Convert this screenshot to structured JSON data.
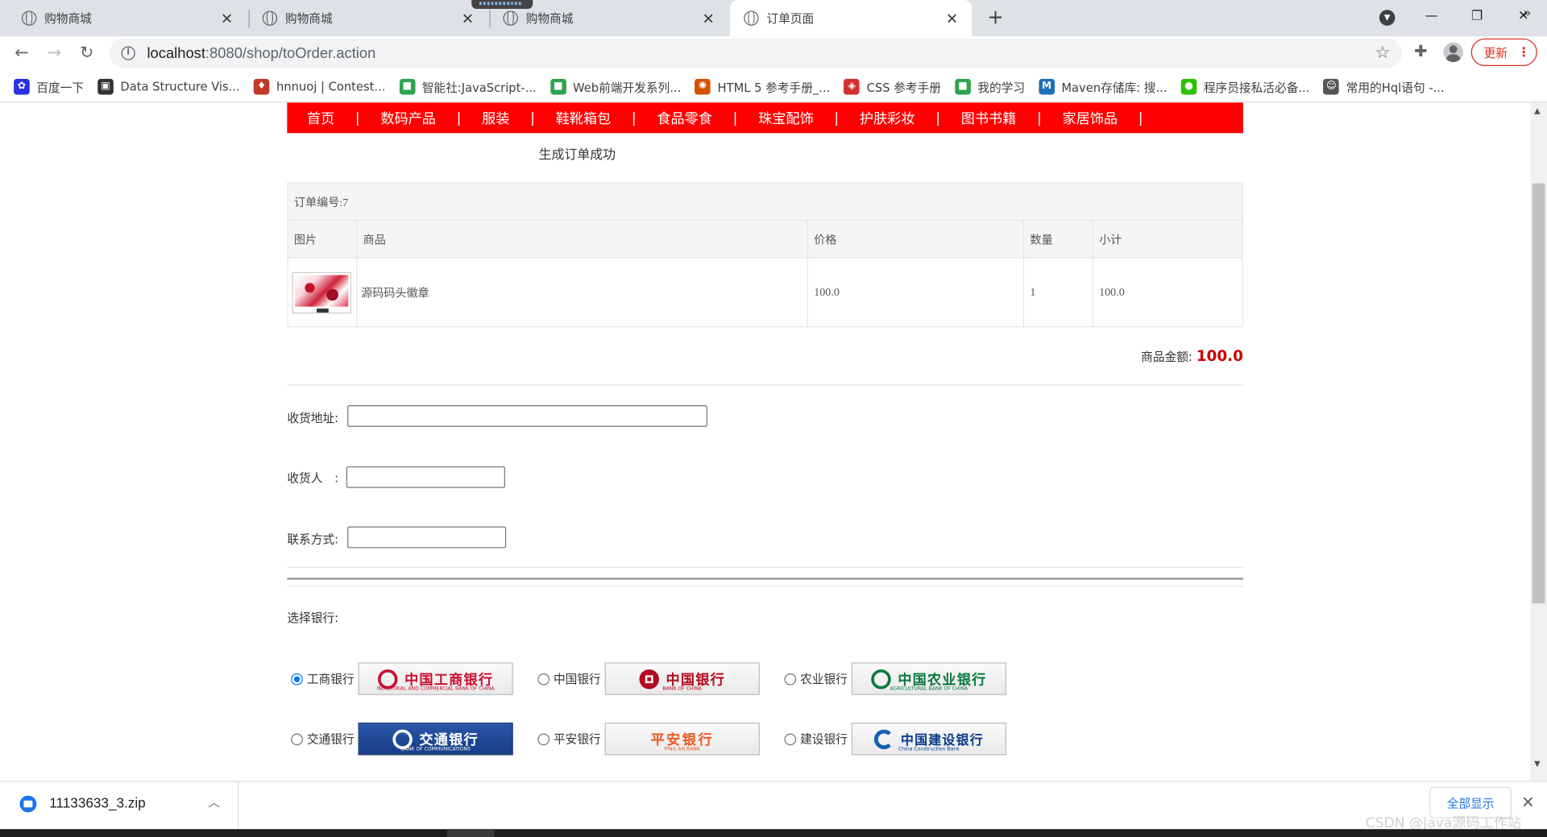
{
  "browser": {
    "tabs": [
      {
        "title": "购物商城"
      },
      {
        "title": "购物商城"
      },
      {
        "title": "购物商城"
      },
      {
        "title": "订单页面"
      }
    ],
    "url_host": "localhost",
    "url_path": ":8080/shop/toOrder.action",
    "update_label": "更新",
    "bookmarks": [
      {
        "label": "百度一下",
        "icon": "paw-icon",
        "color": "#2932e1"
      },
      {
        "label": "Data Structure Vis...",
        "icon": "usf-icon",
        "color": "#333333"
      },
      {
        "label": "hnnuoj | Contest...",
        "icon": "pin-icon",
        "color": "#c0392b"
      },
      {
        "label": "智能社:JavaScript-...",
        "icon": "book-icon",
        "color": "#2da44e"
      },
      {
        "label": "Web前端开发系列...",
        "icon": "book-icon",
        "color": "#2da44e"
      },
      {
        "label": "HTML 5 参考手册_...",
        "icon": "w3-icon",
        "color": "#d35400"
      },
      {
        "label": "CSS 参考手册",
        "icon": "css-icon",
        "color": "#d32f2f"
      },
      {
        "label": "我的学习",
        "icon": "book-icon",
        "color": "#2da44e"
      },
      {
        "label": "Maven存储库: 搜...",
        "icon": "mvn-icon",
        "color": "#1f6fb8"
      },
      {
        "label": "程序员接私活必备...",
        "icon": "wechat-icon",
        "color": "#2dc100"
      },
      {
        "label": "常用的Hql语句 -...",
        "icon": "person-icon",
        "color": "#555555"
      }
    ],
    "more": "»"
  },
  "page": {
    "menu": [
      "首页",
      "数码产品",
      "服装",
      "鞋靴箱包",
      "食品零食",
      "珠宝配饰",
      "护肤彩妆",
      "图书书籍",
      "家居饰品"
    ],
    "menu_sep": "|",
    "success_text": "生成订单成功",
    "order_no": "订单编号:7",
    "columns": [
      "图片",
      "商品",
      "价格",
      "数量",
      "小计"
    ],
    "items": [
      {
        "name": "源码码头徽章",
        "price": "100.0",
        "qty": "1",
        "subtotal": "100.0"
      }
    ],
    "total_label": "商品金额:",
    "total_value": "100.0",
    "fields": {
      "address_label": "收货地址:",
      "address_value": "",
      "receiver_label": "收货人　:",
      "receiver_value": "",
      "phone_label": "联系方式:",
      "phone_value": ""
    },
    "bank_title": "选择银行:",
    "banks": [
      {
        "label": "工商银行",
        "logo_text": "中国工商银行",
        "logo_sub": "INDUSTRIAL AND COMMERCIAL BANK OF CHINA",
        "checked": true
      },
      {
        "label": "中国银行",
        "logo_text": "中国银行",
        "logo_sub": "BANK OF CHINA",
        "checked": false
      },
      {
        "label": "农业银行",
        "logo_text": "中国农业银行",
        "logo_sub": "AGRICULTURAL BANK OF CHINA",
        "checked": false
      },
      {
        "label": "交通银行",
        "logo_text": "交通银行",
        "logo_sub": "BANK OF COMMUNICATIONS",
        "checked": false
      },
      {
        "label": "平安银行",
        "logo_text": "平安银行",
        "logo_sub": "PING AN BANK",
        "checked": false
      },
      {
        "label": "建设银行",
        "logo_text": "中国建设银行",
        "logo_sub": "China Construction Bank",
        "checked": false
      }
    ]
  },
  "download": {
    "filename": "11133633_3.zip",
    "show_all": "全部显示"
  },
  "watermark": "CSDN @Java源码工作站"
}
